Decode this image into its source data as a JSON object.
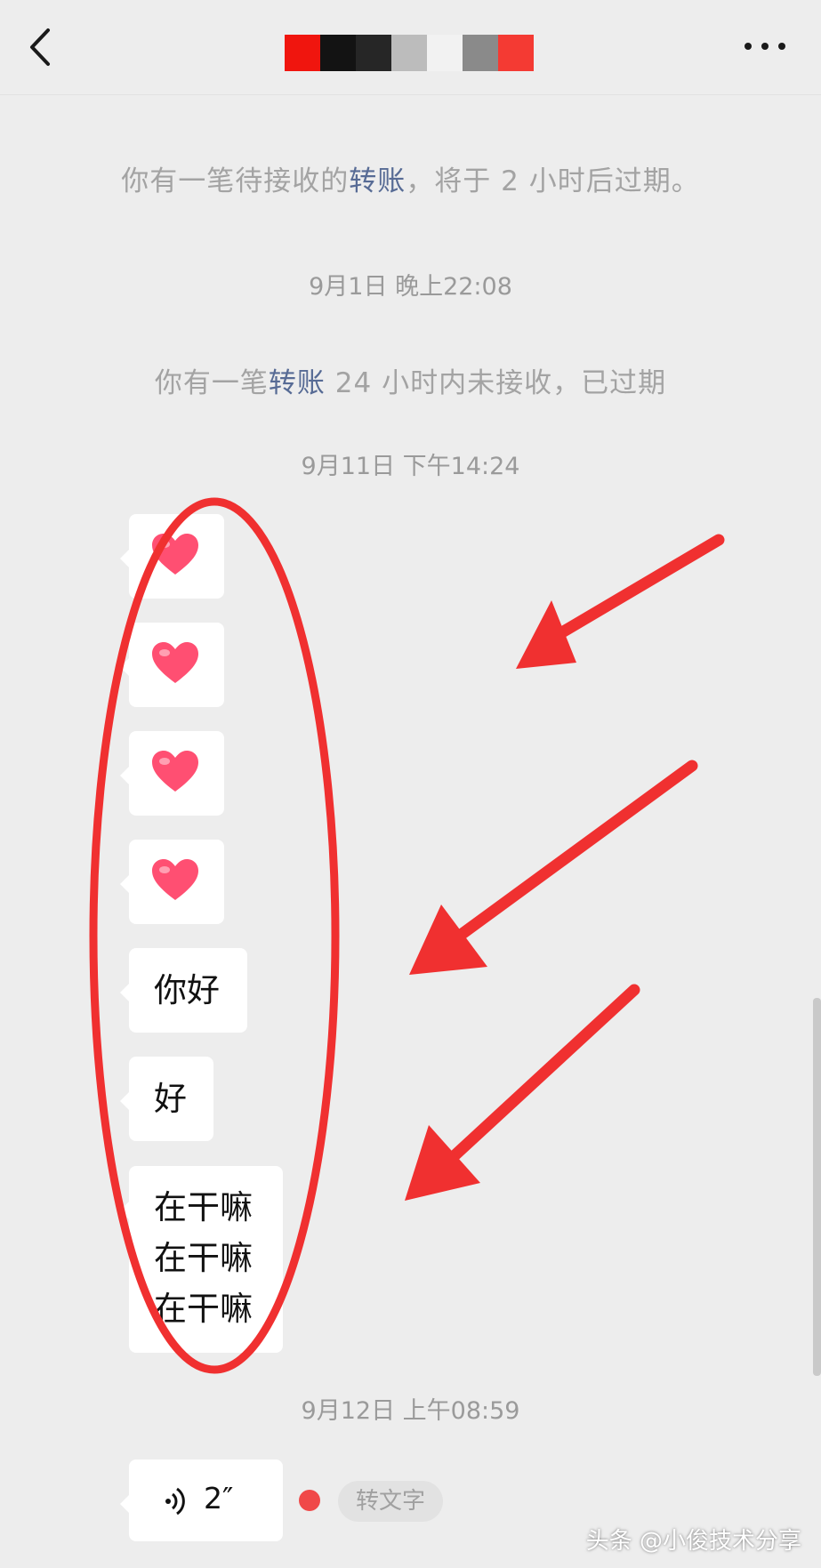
{
  "header": {
    "back_icon": "chevron-left-icon",
    "more_icon": "ellipsis-icon",
    "title_redaction_colors": [
      "#f0150e",
      "#131313",
      "#262626",
      "#bcbcbc",
      "#f2f2f2",
      "#8a8a8a",
      "#f43a33"
    ]
  },
  "system_messages": [
    {
      "prefix": "你有一笔待接收的",
      "link": "转账",
      "suffix": "，将于 2 小时后过期。"
    },
    {
      "prefix": "你有一笔",
      "link": "转账",
      "suffix": " 24 小时内未接收，已过期"
    }
  ],
  "timestamps": {
    "t1": "9月1日 晚上22:08",
    "t2": "9月11日 下午14:24",
    "t3": "9月12日 上午08:59"
  },
  "messages": [
    {
      "type": "emoji",
      "icon": "heart-emoji-icon"
    },
    {
      "type": "emoji",
      "icon": "heart-emoji-icon"
    },
    {
      "type": "emoji",
      "icon": "heart-emoji-icon"
    },
    {
      "type": "emoji",
      "icon": "heart-emoji-icon"
    },
    {
      "type": "text",
      "text": "你好"
    },
    {
      "type": "text",
      "text": "好"
    },
    {
      "type": "text",
      "text": "在干嘛\n在干嘛\n在干嘛"
    }
  ],
  "voice": {
    "icon": "voice-wave-icon",
    "duration": "2″",
    "convert_label": "转文字"
  },
  "colors": {
    "background": "#ededed",
    "bubble": "#ffffff",
    "link": "#576b95",
    "annotation": "#f03030",
    "heart": "#ff4f72"
  },
  "watermark": "头条 @小俊技术分享"
}
